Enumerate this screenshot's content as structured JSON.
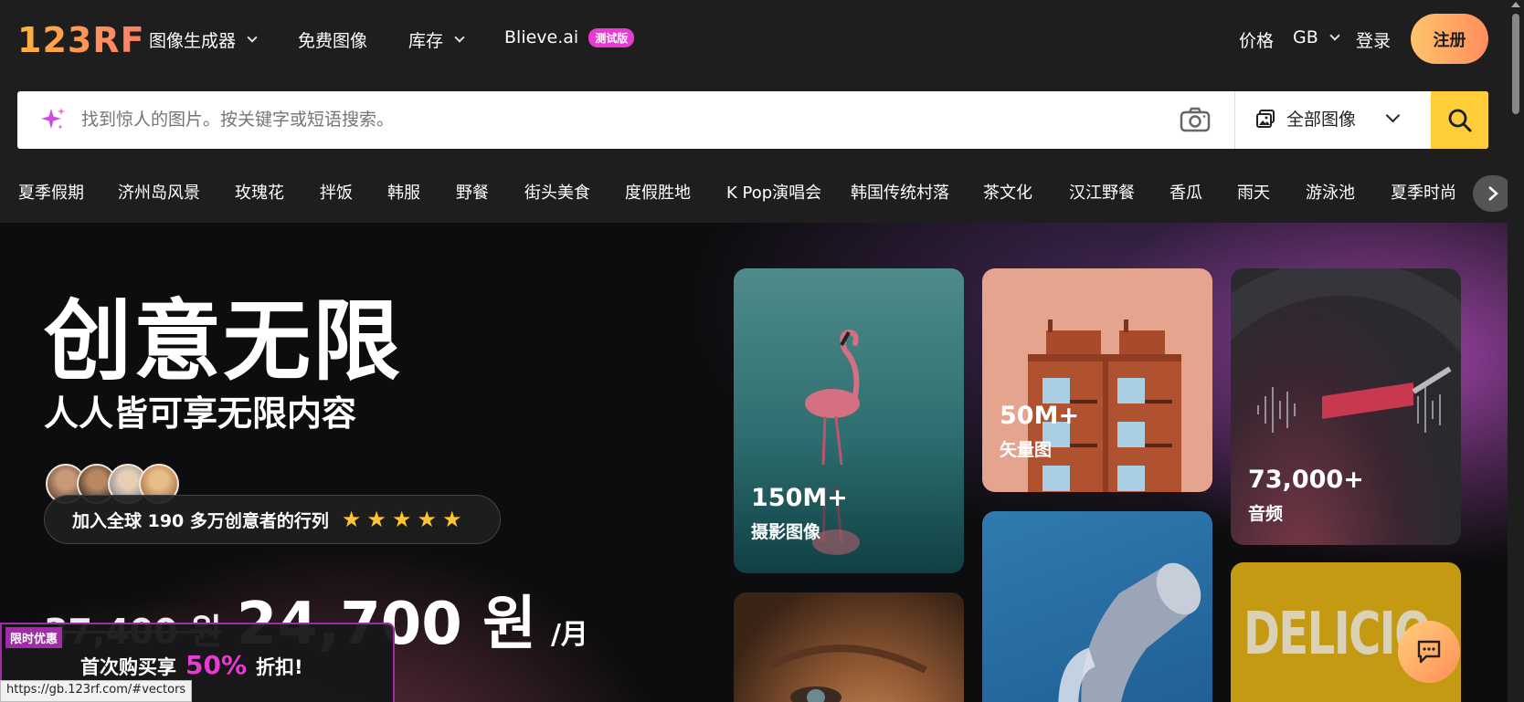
{
  "header": {
    "logo": "123RF",
    "nav": [
      {
        "label": "图像生成器",
        "dropdown": true
      },
      {
        "label": "免费图像",
        "dropdown": false
      },
      {
        "label": "库存",
        "dropdown": true
      },
      {
        "label": "Blieve.ai",
        "badge": "测试版",
        "dropdown": false
      }
    ],
    "price": "价格",
    "region": "GB",
    "login": "登录",
    "signup": "注册"
  },
  "search": {
    "placeholder": "找到惊人的图片。按关键字或短语搜索。",
    "type_label": "全部图像"
  },
  "tags": [
    "夏季假期",
    "济州岛风景",
    "玫瑰花",
    "拌饭",
    "韩服",
    "野餐",
    "街头美食",
    "度假胜地",
    "K Pop演唱会",
    "韩国传统村落",
    "茶文化",
    "汉江野餐",
    "香瓜",
    "雨天",
    "游泳池",
    "夏季时尚"
  ],
  "hero": {
    "title": "创意无限",
    "subtitle": "人人皆可享无限内容",
    "join_text": "加入全球 190 多万创意者的行列",
    "stars": "★★★★★",
    "old_price": "37,400 원",
    "new_price": "24,700 원",
    "per_month": "/月"
  },
  "promo": {
    "badge": "限时优惠",
    "text": "首次购买享",
    "percent": "50%",
    "suffix": "折扣!"
  },
  "cards": {
    "photos": {
      "count": "150M+",
      "label": "摄影图像"
    },
    "vectors": {
      "count": "50M+",
      "label": "矢量图"
    },
    "audio": {
      "count": "73,000+",
      "label": "音频"
    },
    "deli_text": "DELICIO"
  },
  "status_url": "https://gb.123rf.com/#vectors",
  "colors": {
    "accent": "#ffcc3a",
    "brand_pink": "#e93ad4",
    "signup_from": "#ffc46b",
    "signup_to": "#ff8d5e"
  }
}
